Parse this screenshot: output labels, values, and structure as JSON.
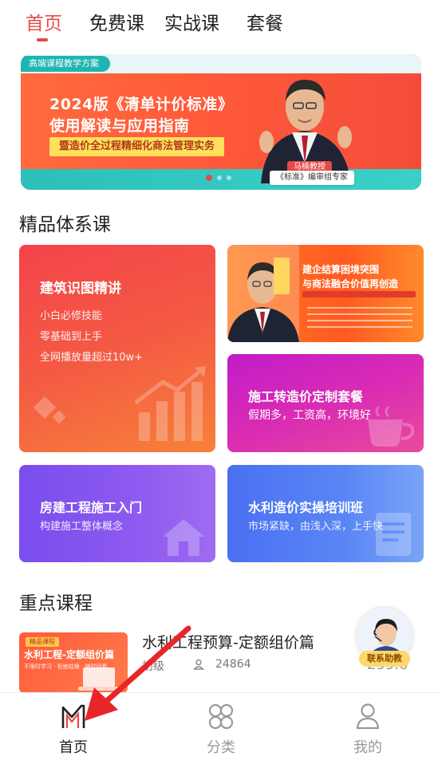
{
  "tabs": [
    {
      "label": "首页",
      "active": true
    },
    {
      "label": "免费课",
      "active": false
    },
    {
      "label": "实战课",
      "active": false
    },
    {
      "label": "套餐",
      "active": false
    }
  ],
  "banner": {
    "top_tag": "高端课程教学方案",
    "title_line1": "2024版《清单计价标准》",
    "title_line2": "使用解读与应用指南",
    "subtitle": "暨造价全过程精细化商法管理实务",
    "name_tag": "马楠教授",
    "role_tag": "《标准》编审组专家",
    "dots": 3,
    "active_dot": 0
  },
  "section_quality": {
    "title": "精品体系课"
  },
  "cards": {
    "big": {
      "title": "建筑识图精讲",
      "lines": [
        "小白必修技能",
        "零基础到上手",
        "全网播放量超过10w+"
      ]
    },
    "image_card": {
      "title_line1": "建企结算困境突围",
      "title_line2": "与商法融合价值再创造",
      "name_tag": "马楠教授"
    },
    "magenta": {
      "title": "施工转造价定制套餐",
      "subtitle": "假期多，工资高，环境好"
    },
    "purple": {
      "title": "房建工程施工入门",
      "subtitle": "构建施工整体概念"
    },
    "blue": {
      "title": "水利造价实操培训班",
      "subtitle": "市场紧缺，由浅入深，上手快"
    }
  },
  "section_key": {
    "title": "重点课程"
  },
  "course": {
    "thumb_tag": "精品课程",
    "thumb_title": "水利工程-定额组价篇",
    "thumb_sub": "不限时学习 · 拒绝枯燥 · 随时回看",
    "title": "水利工程预算-定额组价篇",
    "level": "初级",
    "count": "24864",
    "price": "299.0"
  },
  "assistant": {
    "label": "联系助教"
  },
  "bottom_nav": [
    {
      "label": "首页",
      "icon": "home-logo-icon",
      "active": true
    },
    {
      "label": "分类",
      "icon": "category-icon",
      "active": false
    },
    {
      "label": "我的",
      "icon": "profile-icon",
      "active": false
    }
  ],
  "colors": {
    "accent": "#e5494a",
    "text": "#222222",
    "muted": "#999999"
  }
}
